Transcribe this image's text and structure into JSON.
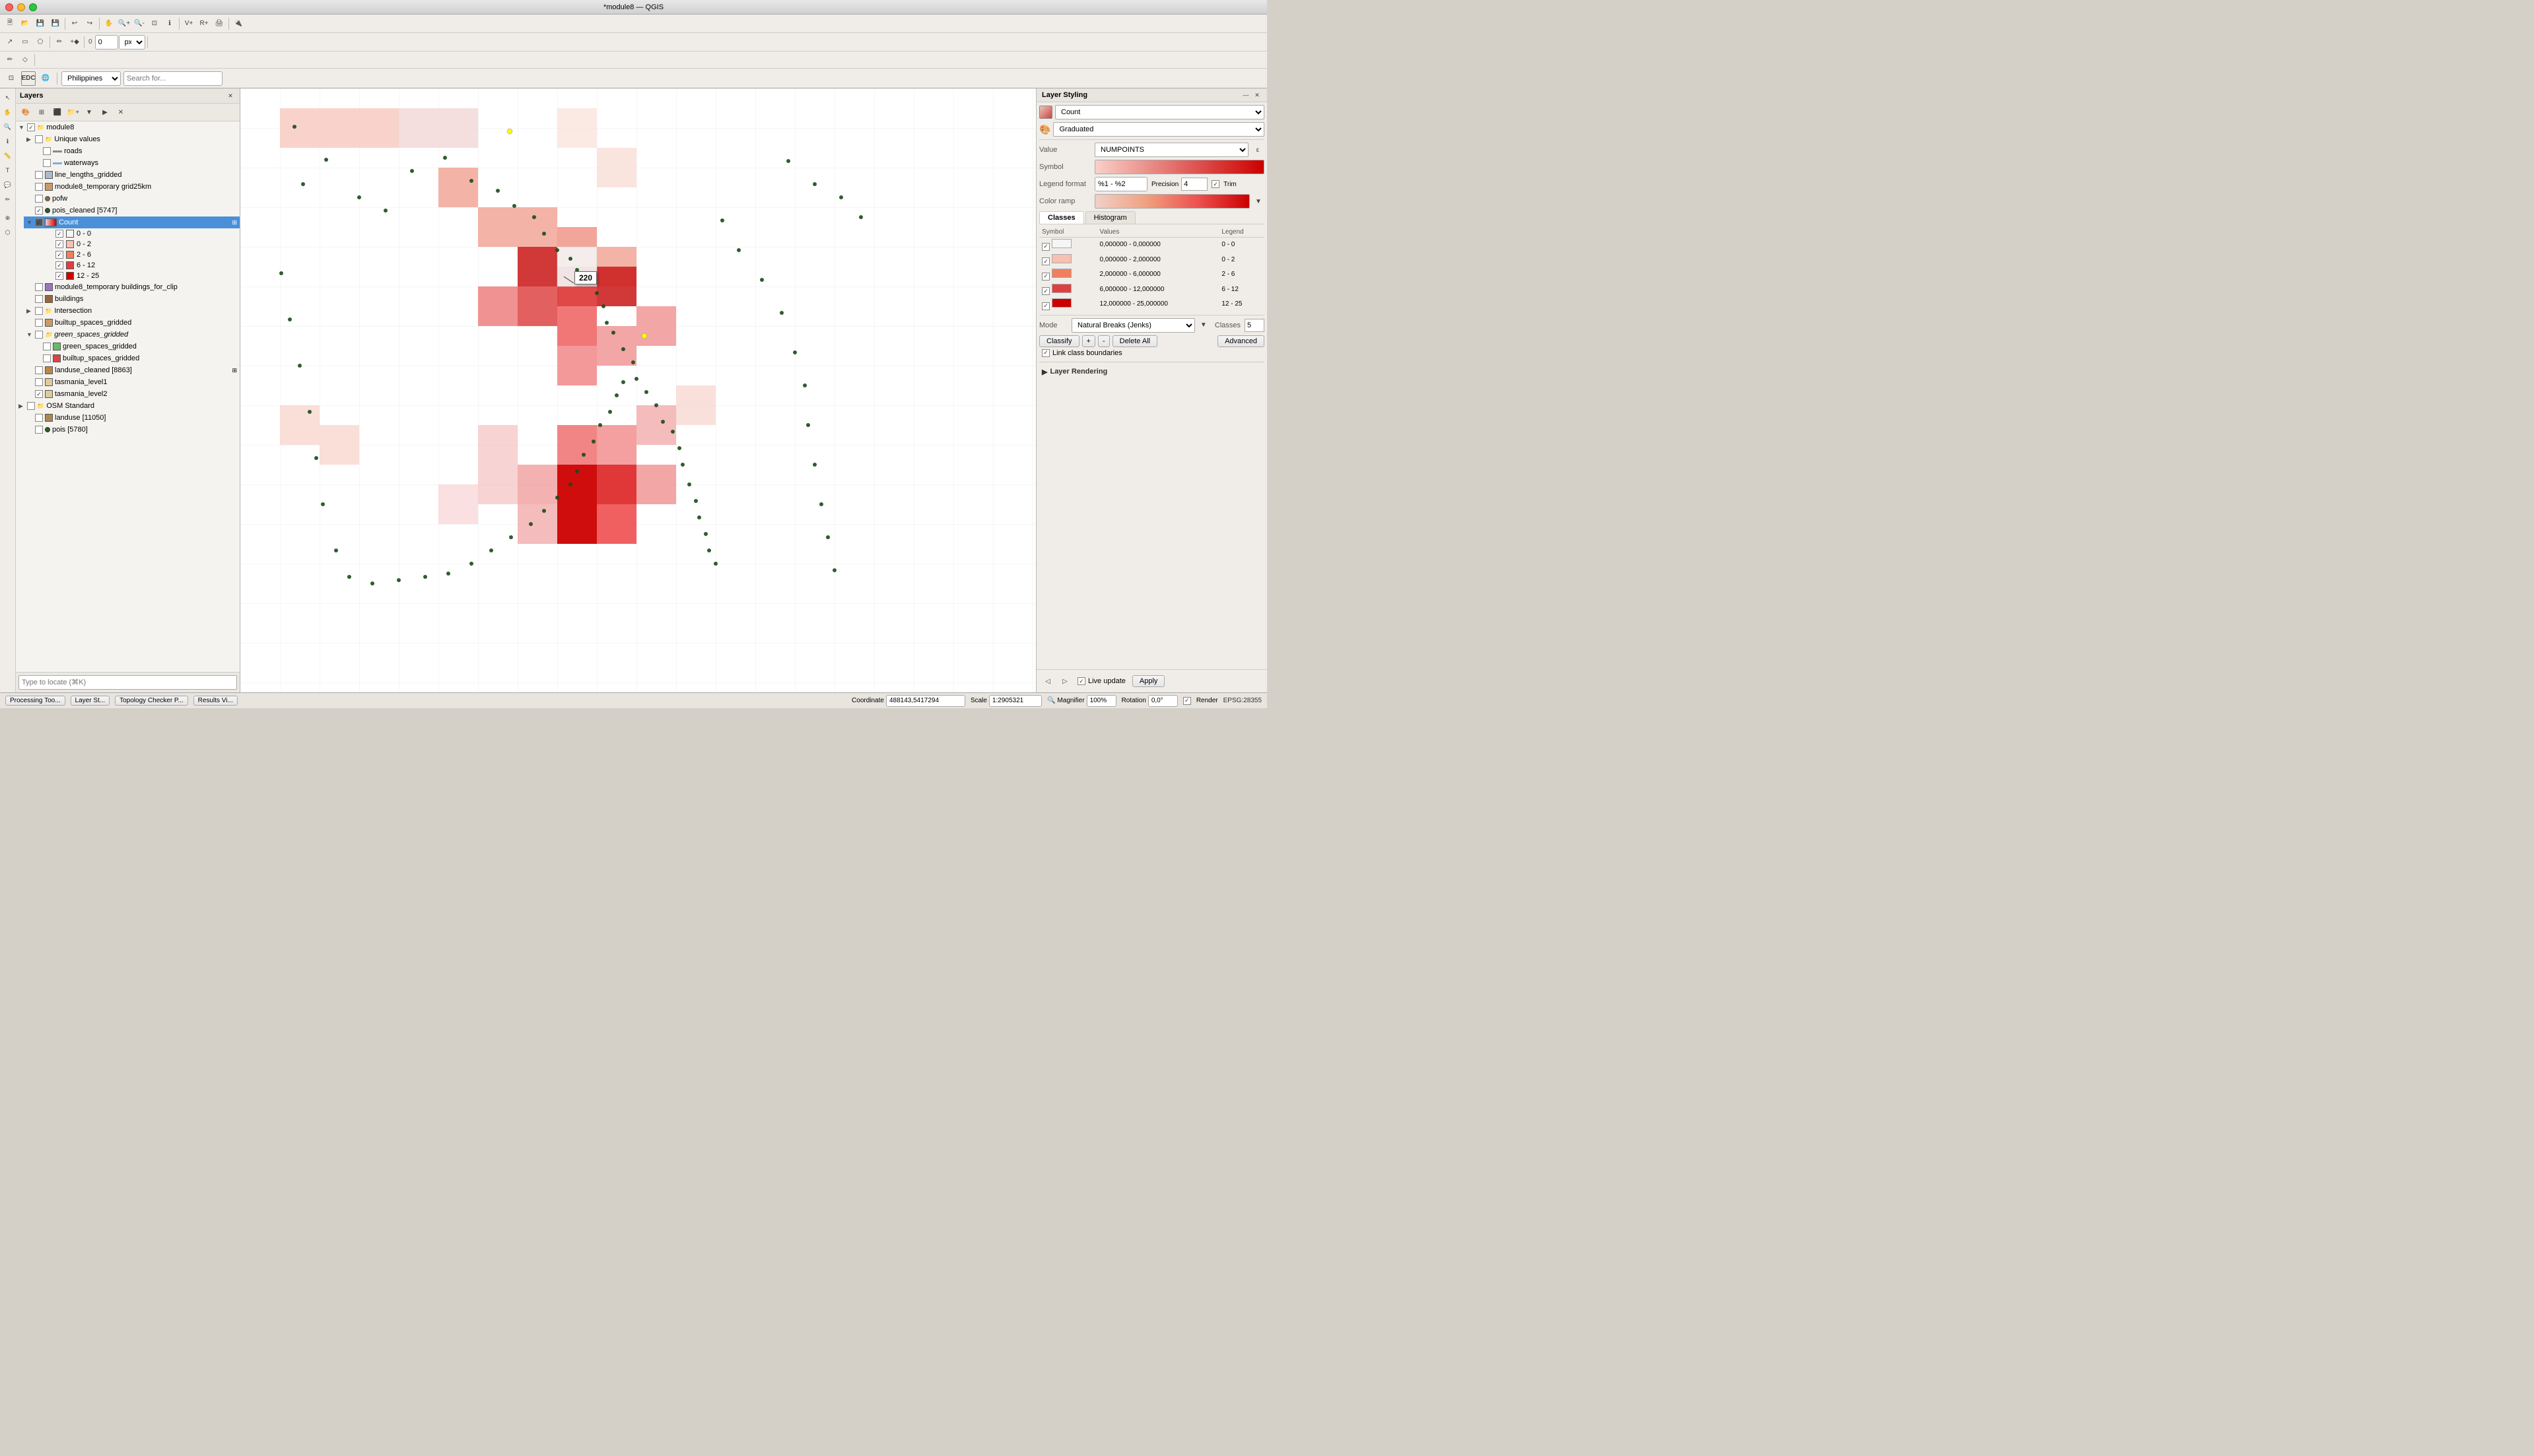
{
  "app": {
    "title": "*module8 — QGIS"
  },
  "titlebar": {
    "buttons": {
      "close": "close",
      "minimize": "minimize",
      "maximize": "maximize"
    }
  },
  "layers_panel": {
    "title": "Layers",
    "items": [
      {
        "id": "module8",
        "label": "module8",
        "type": "group",
        "indent": 0,
        "checked": true,
        "expanded": true
      },
      {
        "id": "unique_values",
        "label": "Unique values",
        "type": "group",
        "indent": 1,
        "checked": false,
        "expanded": false
      },
      {
        "id": "roads",
        "label": "roads",
        "type": "line",
        "indent": 2,
        "checked": false
      },
      {
        "id": "waterways",
        "label": "waterways",
        "type": "line",
        "indent": 2,
        "checked": false
      },
      {
        "id": "line_lengths_gridded",
        "label": "line_lengths_gridded",
        "type": "polygon",
        "indent": 1,
        "checked": false
      },
      {
        "id": "module8_temp_grid",
        "label": "module8_temporary grid25km",
        "type": "polygon",
        "indent": 1,
        "checked": false
      },
      {
        "id": "pofw",
        "label": "pofw",
        "type": "point",
        "indent": 1,
        "checked": false
      },
      {
        "id": "pois_cleaned",
        "label": "pois_cleaned [5747]",
        "type": "point",
        "indent": 1,
        "checked": true
      },
      {
        "id": "Count",
        "label": "Count",
        "type": "raster_graduated",
        "indent": 1,
        "checked": true,
        "selected": true
      },
      {
        "id": "legend_0_0",
        "label": "0 - 0",
        "type": "legend",
        "indent": 2,
        "checked": true,
        "color": "#ffffff"
      },
      {
        "id": "legend_0_2",
        "label": "0 - 2",
        "type": "legend",
        "indent": 2,
        "checked": true,
        "color": "#f8c0b0"
      },
      {
        "id": "legend_2_6",
        "label": "2 - 6",
        "type": "legend",
        "indent": 2,
        "checked": true,
        "color": "#ee8060"
      },
      {
        "id": "legend_6_12",
        "label": "6 - 12",
        "type": "legend",
        "indent": 2,
        "checked": true,
        "color": "#dd4040"
      },
      {
        "id": "legend_12_25",
        "label": "12 - 25",
        "type": "legend",
        "indent": 2,
        "checked": true,
        "color": "#cc0000"
      },
      {
        "id": "module8_temp_buildings",
        "label": "module8_temporary buildings_for_clip",
        "type": "polygon",
        "indent": 1,
        "checked": false
      },
      {
        "id": "buildings",
        "label": "buildings",
        "type": "polygon",
        "indent": 1,
        "checked": false
      },
      {
        "id": "Intersection",
        "label": "Intersection",
        "type": "group",
        "indent": 1,
        "checked": false,
        "expanded": false
      },
      {
        "id": "builtup_spaces_gridded",
        "label": "builtup_spaces_gridded",
        "type": "polygon",
        "indent": 1,
        "checked": false
      },
      {
        "id": "green_spaces_gridded",
        "label": "green_spaces_gridded",
        "type": "polygon",
        "indent": 1,
        "checked": false,
        "selected_grp": true
      },
      {
        "id": "green_spaces_gridded2",
        "label": "green_spaces_gridded",
        "type": "polygon",
        "indent": 2,
        "checked": false
      },
      {
        "id": "builtup_spaces_gridded2",
        "label": "builtup_spaces_gridded",
        "type": "polygon",
        "indent": 2,
        "checked": false
      },
      {
        "id": "landuse_cleaned",
        "label": "landuse_cleaned [8863]",
        "type": "polygon",
        "indent": 1,
        "checked": false
      },
      {
        "id": "tasmania_level1",
        "label": "tasmania_level1",
        "type": "polygon",
        "indent": 1,
        "checked": false
      },
      {
        "id": "tasmania_level2",
        "label": "tasmania_level2",
        "type": "polygon",
        "indent": 1,
        "checked": true
      },
      {
        "id": "osm_standard",
        "label": "OSM Standard",
        "type": "group",
        "indent": 0,
        "checked": false,
        "expanded": false
      },
      {
        "id": "landuse",
        "label": "landuse [11050]",
        "type": "polygon",
        "indent": 1,
        "checked": false
      },
      {
        "id": "pois",
        "label": "pois [5780]",
        "type": "point",
        "indent": 1,
        "checked": false
      }
    ]
  },
  "styling_panel": {
    "title": "Layer Styling",
    "layer_name": "Count",
    "renderer": "Graduated",
    "value_field": "NUMPOINTS",
    "legend_format": "%1 - %2",
    "precision_label": "Precision",
    "precision_value": "4",
    "trim_label": "Trim",
    "color_ramp_label": "Color ramp",
    "tabs": [
      "Classes",
      "Histogram"
    ],
    "active_tab": "Classes",
    "table_headers": [
      "Symbol",
      "Values",
      "Legend"
    ],
    "classes": [
      {
        "symbol_color": "#f5f5f5",
        "values": "0,000000 - 0,000000",
        "legend": "0 - 0"
      },
      {
        "symbol_color": "#f8c0b0",
        "values": "0,000000 - 2,000000",
        "legend": "0 - 2"
      },
      {
        "symbol_color": "#ee8060",
        "values": "2,000000 - 6,000000",
        "legend": "2 - 6"
      },
      {
        "symbol_color": "#dd4040",
        "values": "6,000000 - 12,000000",
        "legend": "6 - 12"
      },
      {
        "symbol_color": "#cc0000",
        "values": "12,000000 - 25,000000",
        "legend": "12 - 25"
      }
    ],
    "mode_label": "Mode",
    "mode_value": "Natural Breaks (Jenks)",
    "classes_label": "Classes",
    "classes_count": "5",
    "classify_btn": "Classify",
    "add_class_btn": "+",
    "delete_btn": "-",
    "delete_all_btn": "Delete All",
    "advanced_btn": "Advanced",
    "link_class_label": "Link class boundaries",
    "layer_rendering_label": "Layer Rendering",
    "live_update_label": "Live update",
    "apply_btn": "Apply"
  },
  "status_bar": {
    "processing": "Processing Too...",
    "layer_st": "Layer St...",
    "topology": "Topology Checker P...",
    "results": "Results Vi...",
    "coordinate_label": "Coordinate",
    "coordinate_value": "488143,5417294",
    "scale_label": "Scale",
    "scale_value": "1:2905321",
    "magnifier_label": "Magnifier",
    "magnifier_value": "100%",
    "rotation_label": "Rotation",
    "rotation_value": "0,0°",
    "render_label": "Render",
    "epsg_value": "EPSG:28355"
  },
  "map": {
    "tooltip_value": "220",
    "tooltip_x_pct": 52,
    "tooltip_y_pct": 46
  }
}
